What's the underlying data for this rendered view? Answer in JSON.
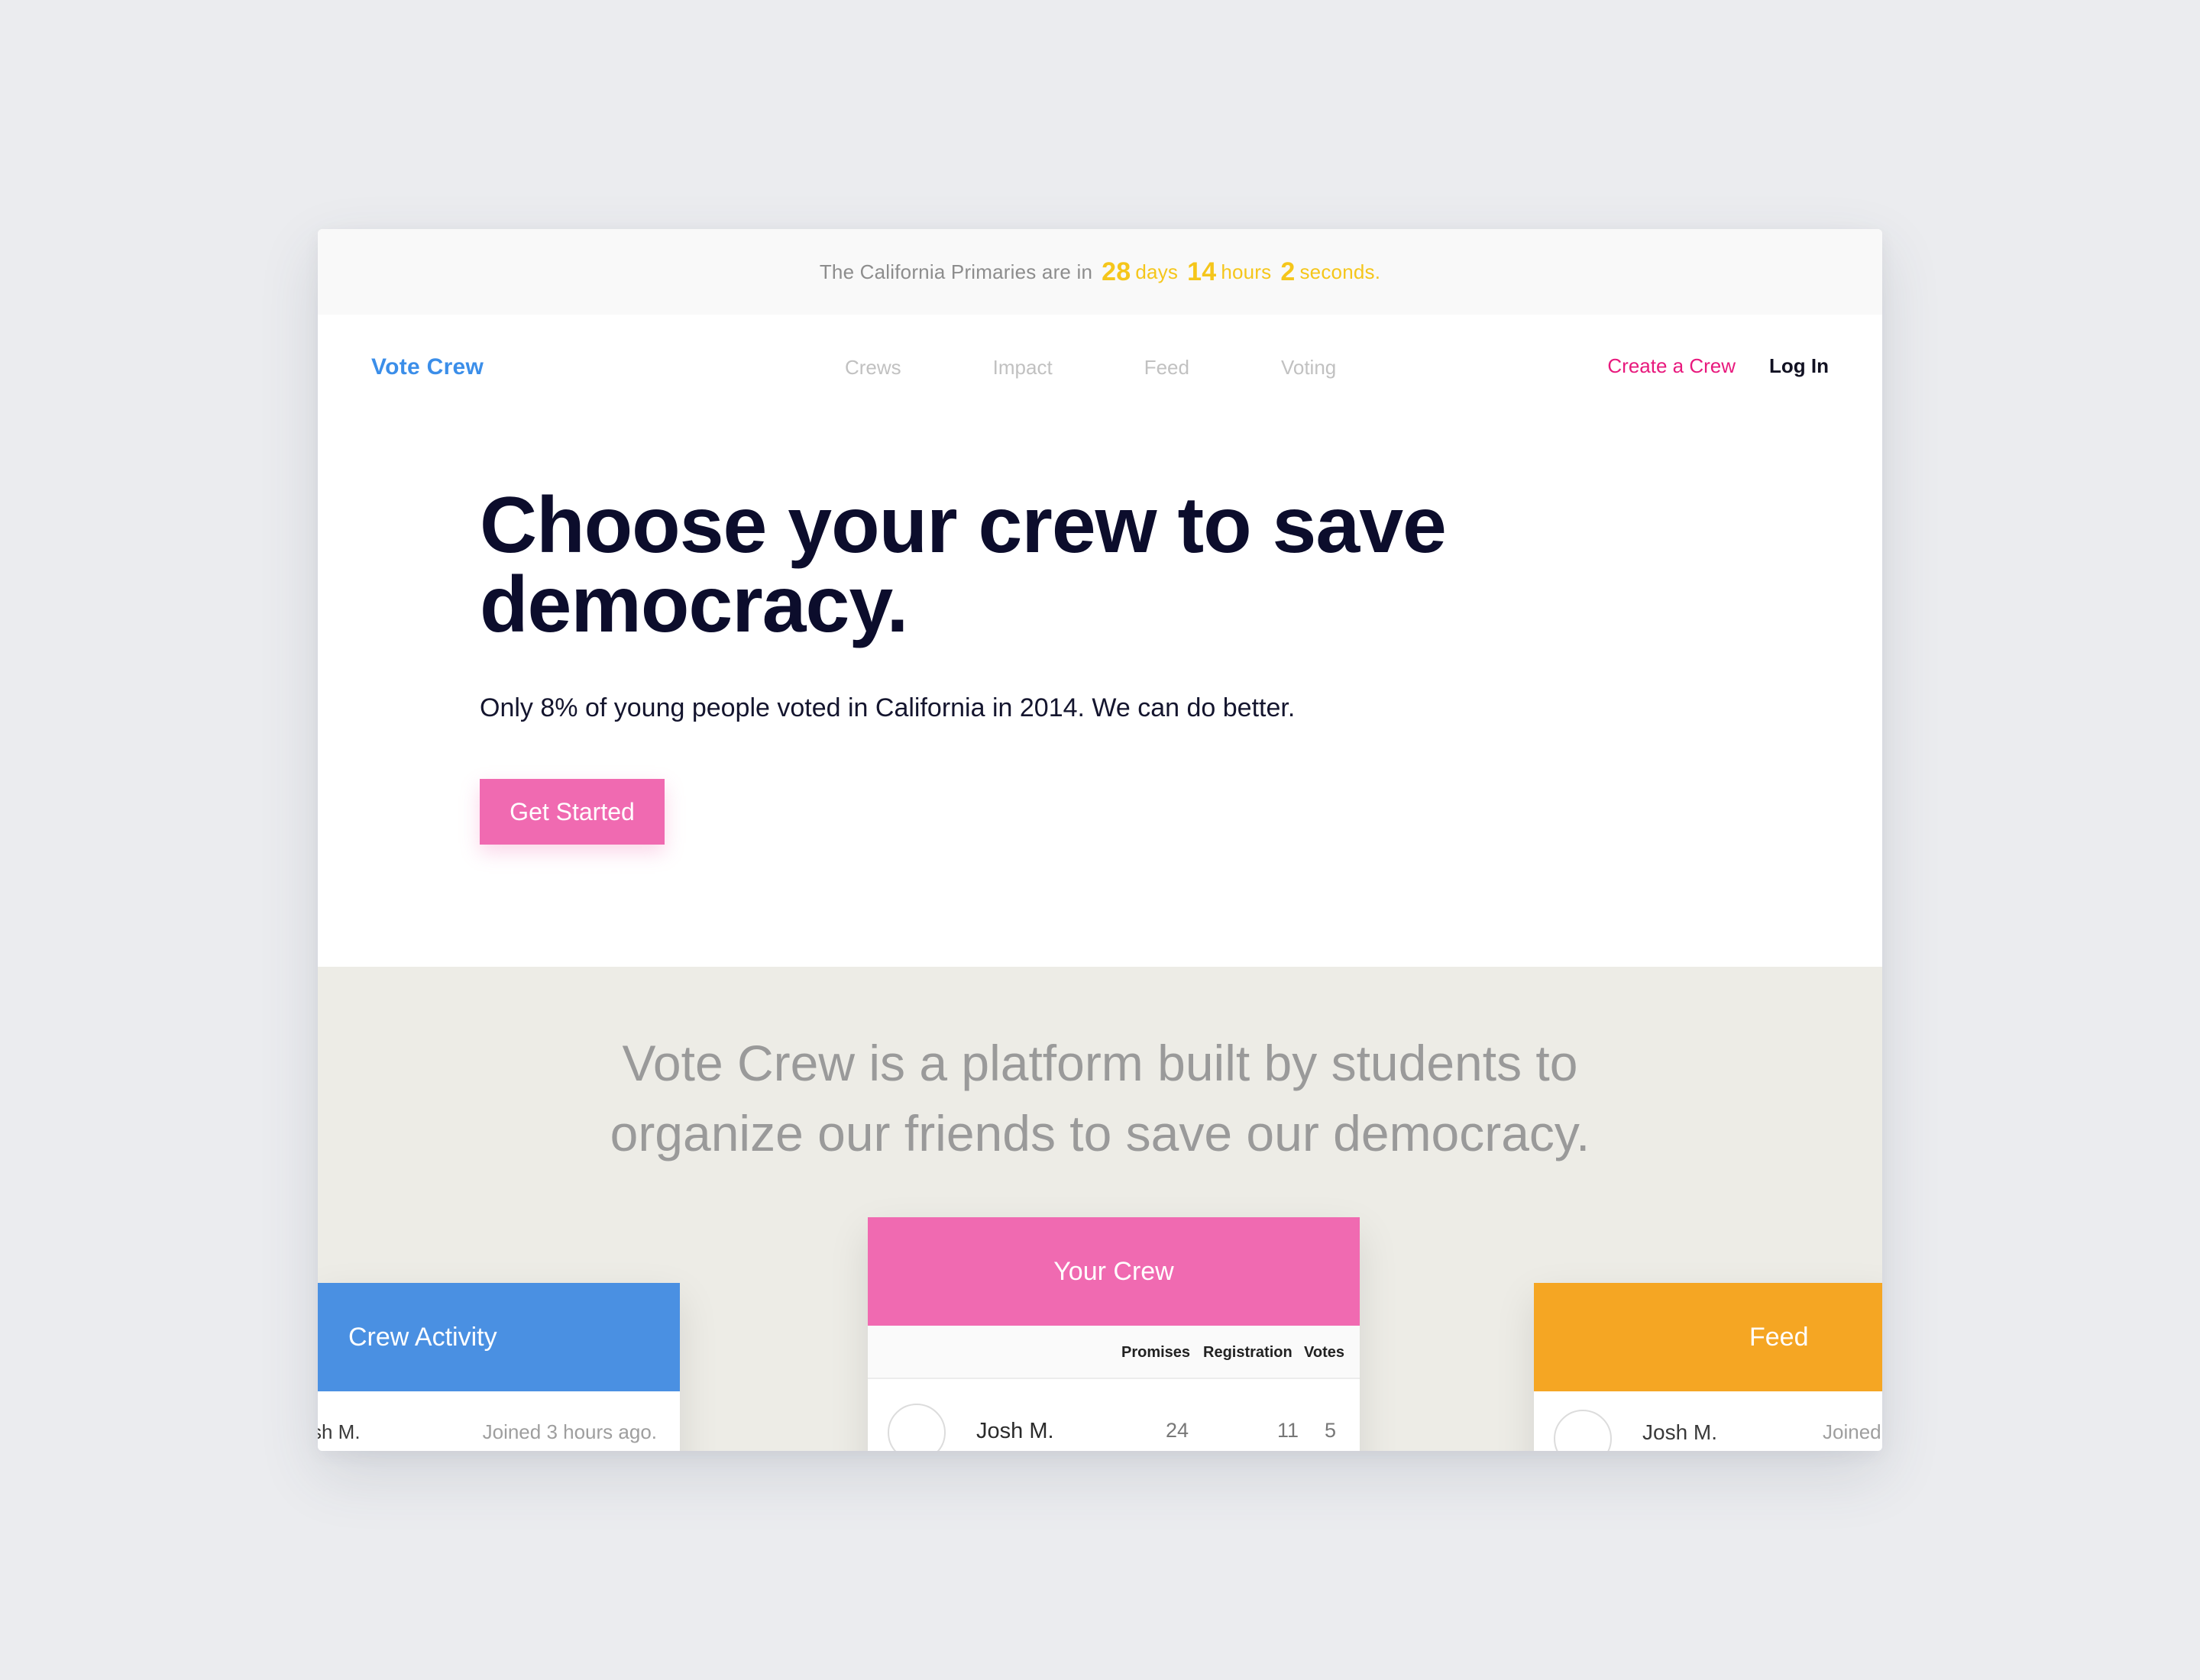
{
  "banner": {
    "prefix": "The California Primaries are in",
    "days_value": "28",
    "days_unit": "days",
    "hours_value": "14",
    "hours_unit": "hours",
    "seconds_value": "2",
    "seconds_unit": "seconds."
  },
  "nav": {
    "logo": "Vote Crew",
    "links": [
      "Crews",
      "Impact",
      "Feed",
      "Voting"
    ],
    "create_label": "Create a Crew",
    "login_label": "Log In"
  },
  "hero": {
    "title": "Choose your crew to save democracy.",
    "subtitle": "Only 8% of young people voted in California in 2014. We can do better.",
    "cta_label": "Get Started"
  },
  "mission": {
    "line1": "Vote Crew is a platform built by students to",
    "line2": "organize our friends to save our democracy."
  },
  "cards": {
    "crew_activity": {
      "title": "Crew Activity",
      "row": {
        "name": "sh M.",
        "time": "Joined 3 hours ago."
      }
    },
    "your_crew": {
      "title": "Your Crew",
      "columns": [
        "Promises",
        "Registration",
        "Votes"
      ],
      "row": {
        "name": "Josh M.",
        "promises": "24",
        "registration": "11",
        "votes": "5"
      }
    },
    "feed": {
      "title": "Feed",
      "row": {
        "name": "Josh M.",
        "time": "Joined"
      }
    }
  },
  "colors": {
    "background": "#ebecef",
    "logo_blue": "#3b8ee9",
    "accent_pink": "#f06ab1",
    "create_pink": "#e8197d",
    "countdown_yellow": "#f5c61b",
    "activity_blue": "#4a90e2",
    "feed_orange": "#f5a623",
    "lower_section": "#edece6"
  }
}
